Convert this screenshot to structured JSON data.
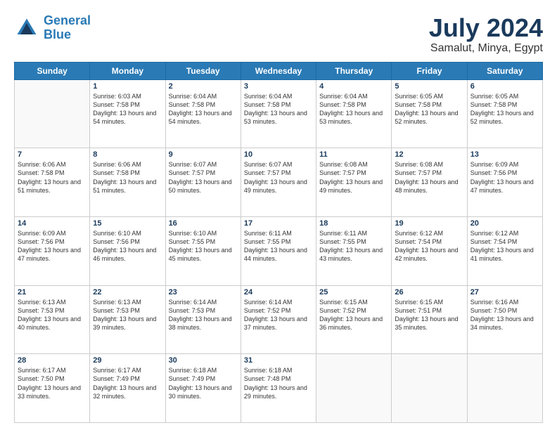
{
  "header": {
    "logo_line1": "General",
    "logo_line2": "Blue",
    "month": "July 2024",
    "location": "Samalut, Minya, Egypt"
  },
  "weekdays": [
    "Sunday",
    "Monday",
    "Tuesday",
    "Wednesday",
    "Thursday",
    "Friday",
    "Saturday"
  ],
  "weeks": [
    [
      {
        "day": "",
        "sunrise": "",
        "sunset": "",
        "daylight": ""
      },
      {
        "day": "1",
        "sunrise": "Sunrise: 6:03 AM",
        "sunset": "Sunset: 7:58 PM",
        "daylight": "Daylight: 13 hours and 54 minutes."
      },
      {
        "day": "2",
        "sunrise": "Sunrise: 6:04 AM",
        "sunset": "Sunset: 7:58 PM",
        "daylight": "Daylight: 13 hours and 54 minutes."
      },
      {
        "day": "3",
        "sunrise": "Sunrise: 6:04 AM",
        "sunset": "Sunset: 7:58 PM",
        "daylight": "Daylight: 13 hours and 53 minutes."
      },
      {
        "day": "4",
        "sunrise": "Sunrise: 6:04 AM",
        "sunset": "Sunset: 7:58 PM",
        "daylight": "Daylight: 13 hours and 53 minutes."
      },
      {
        "day": "5",
        "sunrise": "Sunrise: 6:05 AM",
        "sunset": "Sunset: 7:58 PM",
        "daylight": "Daylight: 13 hours and 52 minutes."
      },
      {
        "day": "6",
        "sunrise": "Sunrise: 6:05 AM",
        "sunset": "Sunset: 7:58 PM",
        "daylight": "Daylight: 13 hours and 52 minutes."
      }
    ],
    [
      {
        "day": "7",
        "sunrise": "Sunrise: 6:06 AM",
        "sunset": "Sunset: 7:58 PM",
        "daylight": "Daylight: 13 hours and 51 minutes."
      },
      {
        "day": "8",
        "sunrise": "Sunrise: 6:06 AM",
        "sunset": "Sunset: 7:58 PM",
        "daylight": "Daylight: 13 hours and 51 minutes."
      },
      {
        "day": "9",
        "sunrise": "Sunrise: 6:07 AM",
        "sunset": "Sunset: 7:57 PM",
        "daylight": "Daylight: 13 hours and 50 minutes."
      },
      {
        "day": "10",
        "sunrise": "Sunrise: 6:07 AM",
        "sunset": "Sunset: 7:57 PM",
        "daylight": "Daylight: 13 hours and 49 minutes."
      },
      {
        "day": "11",
        "sunrise": "Sunrise: 6:08 AM",
        "sunset": "Sunset: 7:57 PM",
        "daylight": "Daylight: 13 hours and 49 minutes."
      },
      {
        "day": "12",
        "sunrise": "Sunrise: 6:08 AM",
        "sunset": "Sunset: 7:57 PM",
        "daylight": "Daylight: 13 hours and 48 minutes."
      },
      {
        "day": "13",
        "sunrise": "Sunrise: 6:09 AM",
        "sunset": "Sunset: 7:56 PM",
        "daylight": "Daylight: 13 hours and 47 minutes."
      }
    ],
    [
      {
        "day": "14",
        "sunrise": "Sunrise: 6:09 AM",
        "sunset": "Sunset: 7:56 PM",
        "daylight": "Daylight: 13 hours and 47 minutes."
      },
      {
        "day": "15",
        "sunrise": "Sunrise: 6:10 AM",
        "sunset": "Sunset: 7:56 PM",
        "daylight": "Daylight: 13 hours and 46 minutes."
      },
      {
        "day": "16",
        "sunrise": "Sunrise: 6:10 AM",
        "sunset": "Sunset: 7:55 PM",
        "daylight": "Daylight: 13 hours and 45 minutes."
      },
      {
        "day": "17",
        "sunrise": "Sunrise: 6:11 AM",
        "sunset": "Sunset: 7:55 PM",
        "daylight": "Daylight: 13 hours and 44 minutes."
      },
      {
        "day": "18",
        "sunrise": "Sunrise: 6:11 AM",
        "sunset": "Sunset: 7:55 PM",
        "daylight": "Daylight: 13 hours and 43 minutes."
      },
      {
        "day": "19",
        "sunrise": "Sunrise: 6:12 AM",
        "sunset": "Sunset: 7:54 PM",
        "daylight": "Daylight: 13 hours and 42 minutes."
      },
      {
        "day": "20",
        "sunrise": "Sunrise: 6:12 AM",
        "sunset": "Sunset: 7:54 PM",
        "daylight": "Daylight: 13 hours and 41 minutes."
      }
    ],
    [
      {
        "day": "21",
        "sunrise": "Sunrise: 6:13 AM",
        "sunset": "Sunset: 7:53 PM",
        "daylight": "Daylight: 13 hours and 40 minutes."
      },
      {
        "day": "22",
        "sunrise": "Sunrise: 6:13 AM",
        "sunset": "Sunset: 7:53 PM",
        "daylight": "Daylight: 13 hours and 39 minutes."
      },
      {
        "day": "23",
        "sunrise": "Sunrise: 6:14 AM",
        "sunset": "Sunset: 7:53 PM",
        "daylight": "Daylight: 13 hours and 38 minutes."
      },
      {
        "day": "24",
        "sunrise": "Sunrise: 6:14 AM",
        "sunset": "Sunset: 7:52 PM",
        "daylight": "Daylight: 13 hours and 37 minutes."
      },
      {
        "day": "25",
        "sunrise": "Sunrise: 6:15 AM",
        "sunset": "Sunset: 7:52 PM",
        "daylight": "Daylight: 13 hours and 36 minutes."
      },
      {
        "day": "26",
        "sunrise": "Sunrise: 6:15 AM",
        "sunset": "Sunset: 7:51 PM",
        "daylight": "Daylight: 13 hours and 35 minutes."
      },
      {
        "day": "27",
        "sunrise": "Sunrise: 6:16 AM",
        "sunset": "Sunset: 7:50 PM",
        "daylight": "Daylight: 13 hours and 34 minutes."
      }
    ],
    [
      {
        "day": "28",
        "sunrise": "Sunrise: 6:17 AM",
        "sunset": "Sunset: 7:50 PM",
        "daylight": "Daylight: 13 hours and 33 minutes."
      },
      {
        "day": "29",
        "sunrise": "Sunrise: 6:17 AM",
        "sunset": "Sunset: 7:49 PM",
        "daylight": "Daylight: 13 hours and 32 minutes."
      },
      {
        "day": "30",
        "sunrise": "Sunrise: 6:18 AM",
        "sunset": "Sunset: 7:49 PM",
        "daylight": "Daylight: 13 hours and 30 minutes."
      },
      {
        "day": "31",
        "sunrise": "Sunrise: 6:18 AM",
        "sunset": "Sunset: 7:48 PM",
        "daylight": "Daylight: 13 hours and 29 minutes."
      },
      {
        "day": "",
        "sunrise": "",
        "sunset": "",
        "daylight": ""
      },
      {
        "day": "",
        "sunrise": "",
        "sunset": "",
        "daylight": ""
      },
      {
        "day": "",
        "sunrise": "",
        "sunset": "",
        "daylight": ""
      }
    ]
  ]
}
